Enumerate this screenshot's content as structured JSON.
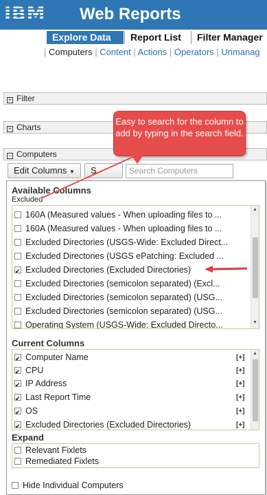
{
  "header": {
    "logo": "IBM",
    "title": "Web Reports"
  },
  "tabs": [
    {
      "label": "Explore Data"
    },
    {
      "label": "Report List"
    },
    {
      "label": "Filter Manager"
    }
  ],
  "subnav": {
    "current": "Computers",
    "links": [
      "Content",
      "Actions",
      "Operators",
      "Unmanag"
    ]
  },
  "panels": {
    "filter": "Filter",
    "charts": "Charts",
    "computers": "Computers",
    "plus": "+",
    "minus": "−"
  },
  "toolbar": {
    "edit_columns": "Edit Columns",
    "second_button": "S",
    "search_placeholder": "Search Computers"
  },
  "callout": "Easy to search for the column to add by typing in the search field.",
  "available": {
    "heading": "Available Columns",
    "filter_value": "Excluded",
    "items": [
      {
        "label": "160A (Measured values - When uploading files to ...",
        "checked": false
      },
      {
        "label": "160A (Measured values - When uploading files to ...",
        "checked": false
      },
      {
        "label": "Excluded Directories (USGS-Wide: Excluded Direct...",
        "checked": false
      },
      {
        "label": "Excluded Directories (USGS ePatching: Excluded ...",
        "checked": false
      },
      {
        "label": "Excluded Directories (Excluded Directories)",
        "checked": true
      },
      {
        "label": "Excluded Directories (semicolon separated) (Excl...",
        "checked": false
      },
      {
        "label": "Excluded Directories (semicolon separated) (USG...",
        "checked": false
      },
      {
        "label": "Excluded Directories (semicolon separated) (USG...",
        "checked": false
      },
      {
        "label": "Operating System (USGS-Wide: Excluded Directo...",
        "checked": false
      }
    ]
  },
  "current": {
    "heading": "Current Columns",
    "add_label": "[+]",
    "items": [
      {
        "label": "Computer Name",
        "checked": true
      },
      {
        "label": "CPU",
        "checked": true
      },
      {
        "label": "IP Address",
        "checked": true
      },
      {
        "label": "Last Report Time",
        "checked": true
      },
      {
        "label": "OS",
        "checked": true
      },
      {
        "label": "Excluded Directories (Excluded Directories)",
        "checked": true
      }
    ]
  },
  "expand": {
    "heading": "Expand",
    "items": [
      {
        "label": "Relevant Fixlets",
        "checked": false
      },
      {
        "label": "Remediated Fixlets",
        "checked": false
      }
    ]
  },
  "hide_individual": {
    "label": "Hide Individual Computers",
    "checked": false
  },
  "colors": {
    "header": "#2f77b4",
    "callout": "#e74c4c",
    "link": "#2a6fb0"
  }
}
